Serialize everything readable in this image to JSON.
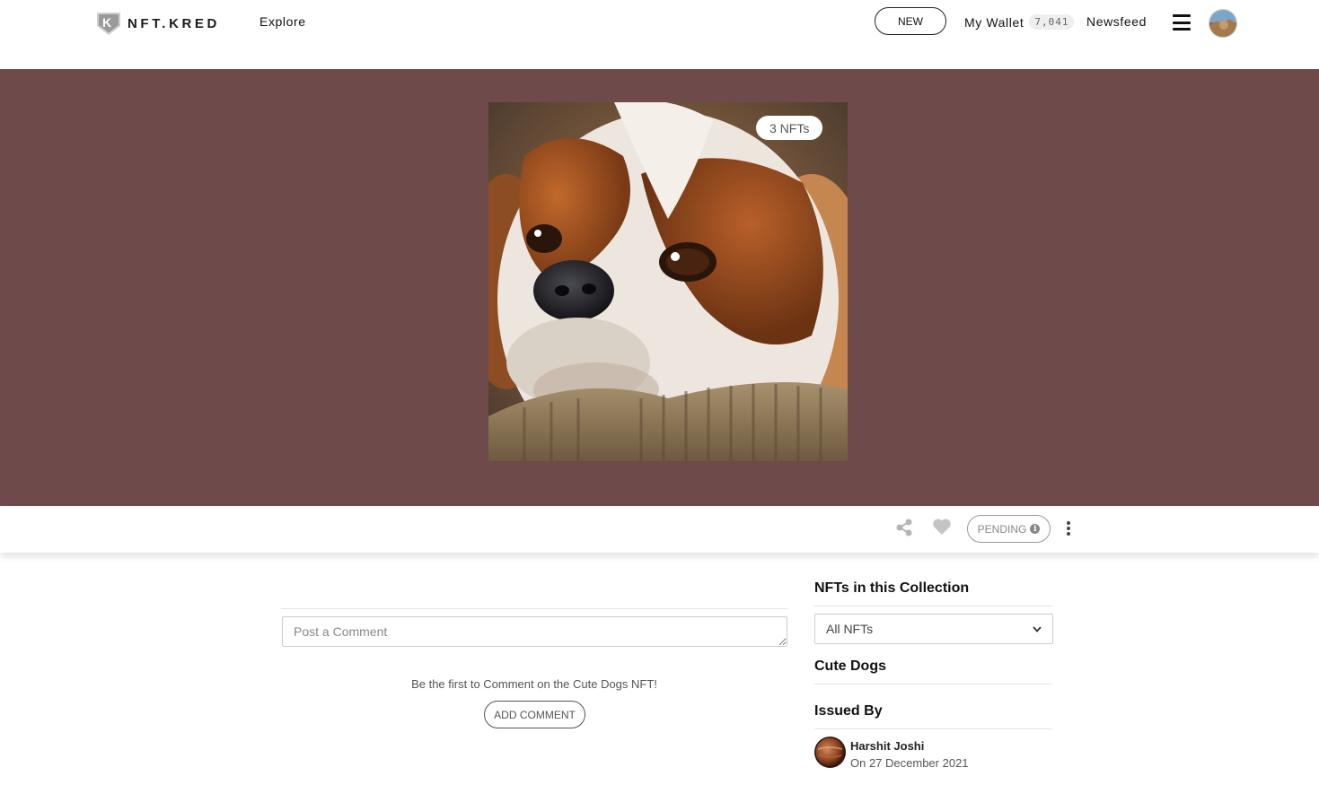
{
  "nav": {
    "brand": "NFT.KRED",
    "explore": "Explore",
    "new_button": "NEW",
    "wallet_label": "My Wallet",
    "wallet_count": "7,041",
    "newsfeed": "Newsfeed"
  },
  "hero": {
    "background_color": "#6e4a4a",
    "nft_count_badge": "3 NFTs"
  },
  "actions": {
    "pending_label": "PENDING"
  },
  "comments": {
    "placeholder": "Post a Comment",
    "empty_message": "Be the first to Comment on the Cute Dogs NFT!",
    "add_button": "ADD COMMENT"
  },
  "sidebar": {
    "collection_heading": "NFTs in this Collection",
    "filter_selected": "All NFTs",
    "collection_name": "Cute Dogs",
    "issued_heading": "Issued By",
    "issuer_name": "Harshit Joshi",
    "issued_date": "On 27 December 2021"
  }
}
